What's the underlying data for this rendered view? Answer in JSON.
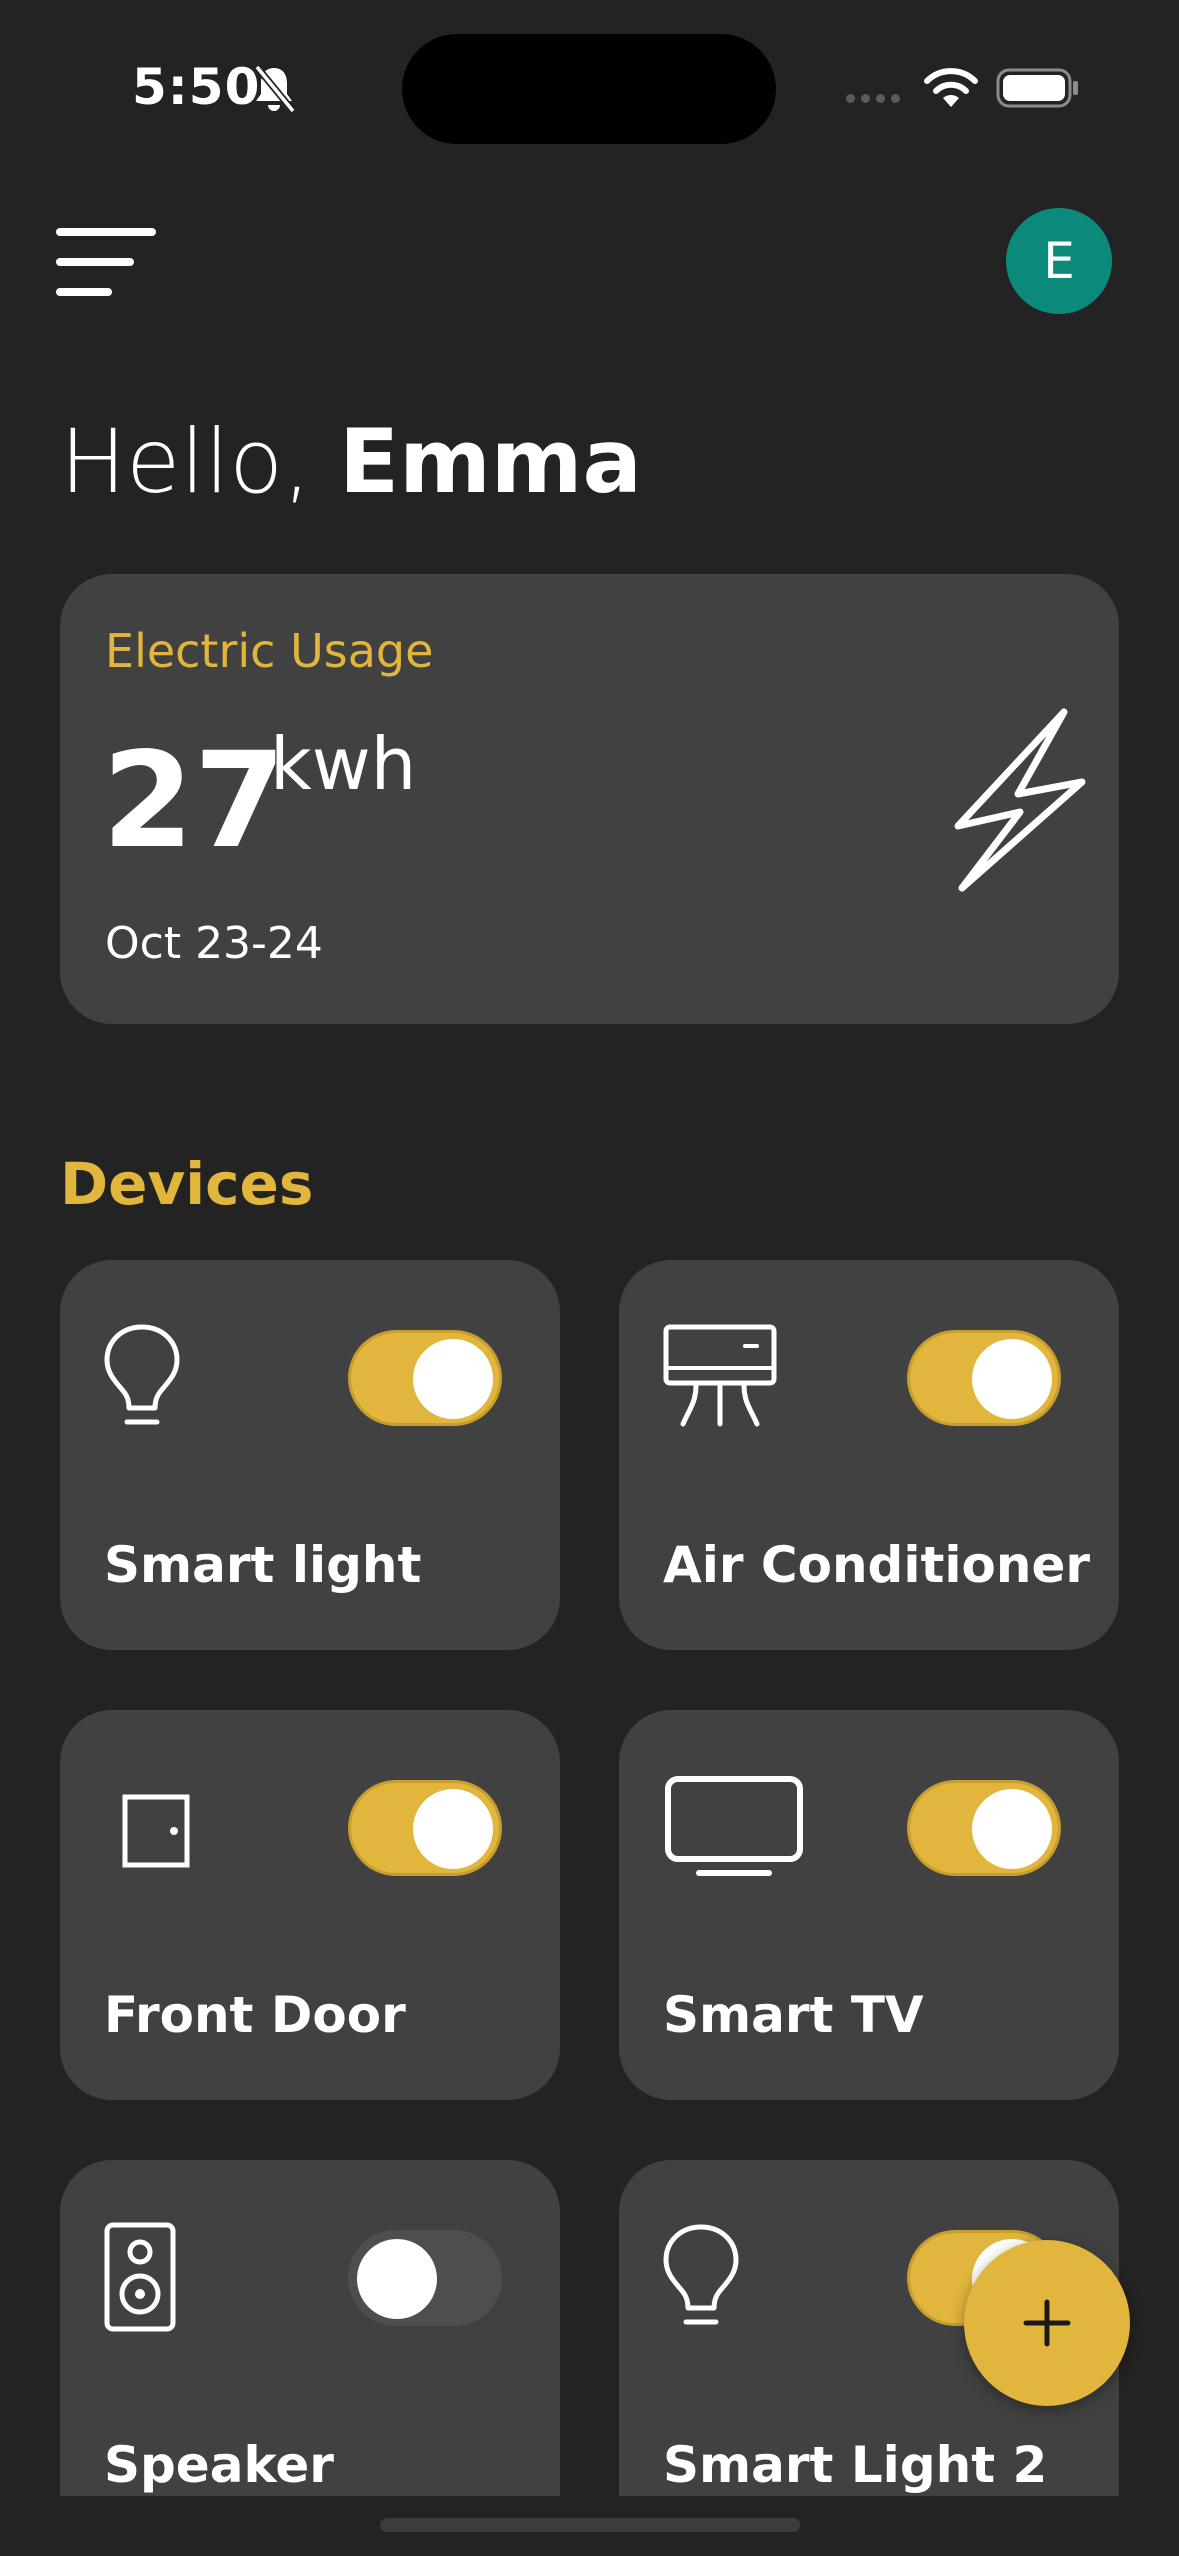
{
  "status_bar": {
    "time": "5:50",
    "icons": [
      "bell-slash-icon",
      "signal-icon",
      "wifi-icon",
      "battery-icon"
    ]
  },
  "header": {
    "menu_icon": "menu-icon",
    "avatar_initial": "E",
    "avatar_color": "#0b8a7c"
  },
  "greeting": {
    "prefix": "Hello, ",
    "name": "Emma"
  },
  "usage": {
    "title": "Electric Usage",
    "value": "27",
    "unit": "kwh",
    "date_range": "Oct 23-24",
    "icon": "lightning-bolt-icon"
  },
  "devices": {
    "title": "Devices",
    "items": [
      {
        "label": "Smart light",
        "icon": "light-bulb-icon",
        "on": true
      },
      {
        "label": "Air Conditioner",
        "icon": "air-conditioner-icon",
        "on": true
      },
      {
        "label": "Front Door",
        "icon": "door-icon",
        "on": true
      },
      {
        "label": "Smart TV",
        "icon": "tv-icon",
        "on": true
      },
      {
        "label": "Speaker",
        "icon": "speaker-icon",
        "on": false
      },
      {
        "label": "Smart Light 2",
        "icon": "light-bulb-icon",
        "on": true
      }
    ]
  },
  "fab": {
    "icon": "plus-icon"
  },
  "colors": {
    "background": "#232323",
    "card": "#414141",
    "accent": "#e2b53c"
  }
}
